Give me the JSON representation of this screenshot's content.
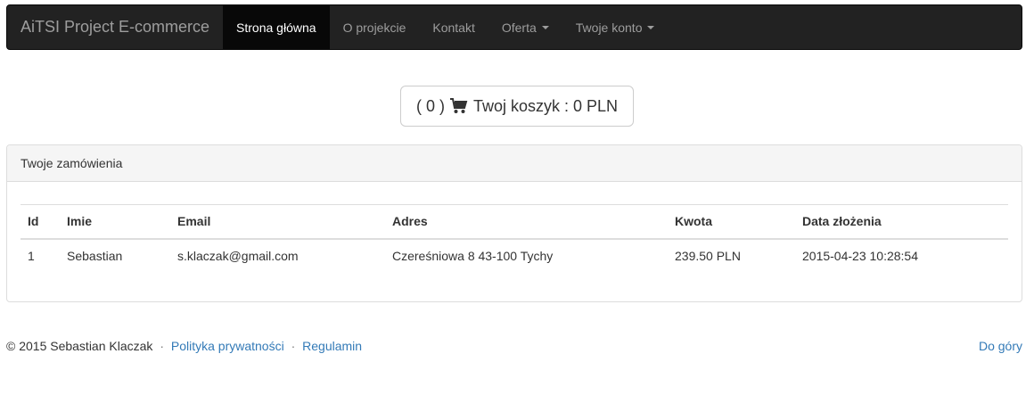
{
  "navbar": {
    "brand": "AiTSI Project E-commerce",
    "items": [
      {
        "label": "Strona główna",
        "active": true
      },
      {
        "label": "O projekcie"
      },
      {
        "label": "Kontakt"
      },
      {
        "label": "Oferta",
        "dropdown": true
      },
      {
        "label": "Twoje konto",
        "dropdown": true
      }
    ]
  },
  "cart": {
    "count": "( 0 )",
    "label": "Twoj koszyk : 0 PLN",
    "icon": "cart-icon"
  },
  "orders_panel": {
    "title": "Twoje zamówienia",
    "columns": [
      "Id",
      "Imie",
      "Email",
      "Adres",
      "Kwota",
      "Data złożenia"
    ],
    "rows": [
      [
        "1",
        "Sebastian",
        "s.klaczak@gmail.com",
        "Czereśniowa 8 43-100 Tychy",
        "239.50 PLN",
        "2015-04-23 10:28:54"
      ]
    ]
  },
  "footer": {
    "copyright": "© 2015 Sebastian Klaczak",
    "separator": "·",
    "privacy_link": "Polityka prywatności",
    "terms_link": "Regulamin",
    "top_link": "Do góry"
  },
  "colors": {
    "navbar_bg": "#222222",
    "link": "#337ab7"
  }
}
